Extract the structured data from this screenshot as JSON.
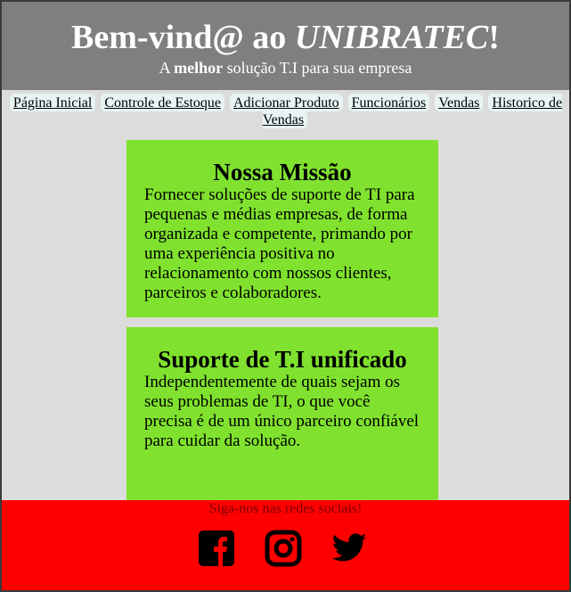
{
  "header": {
    "title_prefix": "Bem-vind@ ao ",
    "title_brand": "UNIBRATEC",
    "title_suffix": "!",
    "tagline_prefix": "A ",
    "tagline_bold": "melhor",
    "tagline_suffix": " solução T.I para sua empresa"
  },
  "nav": {
    "items": [
      {
        "label": "Página Inicial"
      },
      {
        "label": "Controle de Estoque"
      },
      {
        "label": "Adicionar Produto"
      },
      {
        "label": "Funcionários"
      },
      {
        "label": "Vendas"
      },
      {
        "label": "Historico de Vendas"
      }
    ]
  },
  "main": {
    "cards": [
      {
        "title": "Nossa Missão",
        "text": "Fornecer soluções de suporte de TI para pequenas e médias empresas, de forma organizada e competente, primando por uma experiência positiva no relacionamento com nossos clientes, parceiros e colaboradores."
      },
      {
        "title": "Suporte de T.I unificado",
        "text": "Independentemente de quais sejam os seus problemas de TI, o que você precisa é de um único parceiro confiável para cuidar da solução."
      }
    ]
  },
  "footer": {
    "follow_text": "Siga-nos nas redes sociais!",
    "socials": [
      {
        "icon": "facebook-icon"
      },
      {
        "icon": "instagram-icon"
      },
      {
        "icon": "twitter-icon"
      }
    ]
  },
  "colors": {
    "header_bg": "#7f7f7f",
    "page_bg": "#dcdcdc",
    "card_bg": "#80e22e",
    "footer_bg": "#ff0000"
  }
}
